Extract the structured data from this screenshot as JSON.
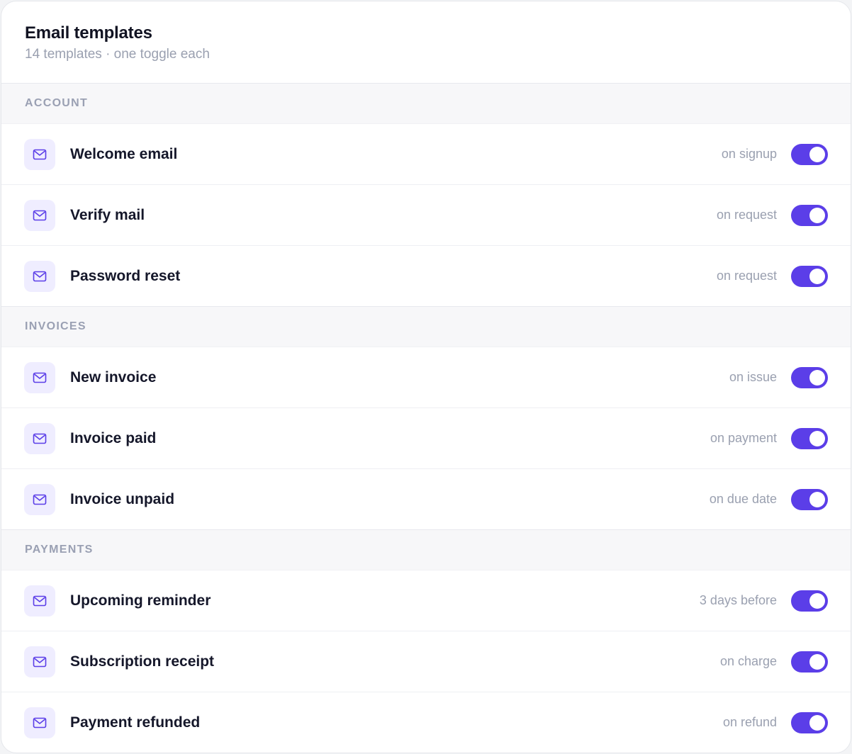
{
  "header": {
    "title": "Email templates",
    "subtitle": "14 templates · one toggle each"
  },
  "sections": [
    {
      "name": "ACCOUNT",
      "items": [
        {
          "label": "Welcome email",
          "trigger": "on signup",
          "enabled": true,
          "icon": "mail-icon"
        },
        {
          "label": "Verify mail",
          "trigger": "on request",
          "enabled": true,
          "icon": "mail-icon"
        },
        {
          "label": "Password reset",
          "trigger": "on request",
          "enabled": true,
          "icon": "mail-icon"
        }
      ]
    },
    {
      "name": "INVOICES",
      "items": [
        {
          "label": "New invoice",
          "trigger": "on issue",
          "enabled": true,
          "icon": "mail-icon"
        },
        {
          "label": "Invoice paid",
          "trigger": "on payment",
          "enabled": true,
          "icon": "mail-icon"
        },
        {
          "label": "Invoice unpaid",
          "trigger": "on due date",
          "enabled": true,
          "icon": "mail-icon"
        }
      ]
    },
    {
      "name": "PAYMENTS",
      "items": [
        {
          "label": "Upcoming reminder",
          "trigger": "3 days before",
          "enabled": true,
          "icon": "mail-icon"
        },
        {
          "label": "Subscription receipt",
          "trigger": "on charge",
          "enabled": true,
          "icon": "mail-icon"
        },
        {
          "label": "Payment refunded",
          "trigger": "on refund",
          "enabled": true,
          "icon": "mail-icon"
        }
      ]
    }
  ],
  "colors": {
    "accent": "#5b3ee8",
    "icon_bg": "#efedff",
    "section_bg": "#f7f7f9"
  }
}
